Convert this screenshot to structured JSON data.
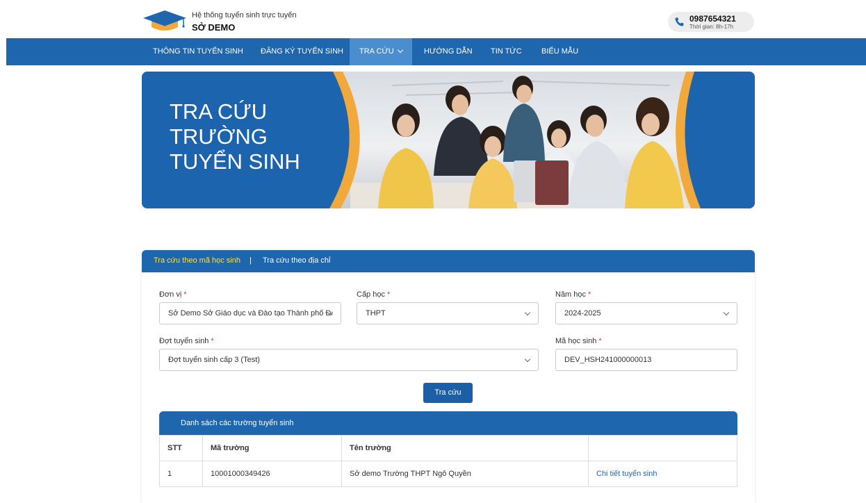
{
  "header": {
    "subtitle": "Hệ thống tuyển sinh trực tuyến",
    "title": "SỞ DEMO",
    "hotline": "0987654321",
    "hours": "Thời gian: 8h-17h"
  },
  "nav": {
    "items": [
      {
        "label": "THÔNG TIN TUYỂN SINH"
      },
      {
        "label": "ĐĂNG KÝ TUYỂN SINH"
      },
      {
        "label": "TRA CỨU"
      },
      {
        "label": "HƯỚNG DẪN"
      },
      {
        "label": "TIN TỨC"
      },
      {
        "label": "BIỂU MẪU"
      }
    ],
    "active_index": 2
  },
  "banner": {
    "line1": "TRA CỨU",
    "line2": "TRƯỜNG",
    "line3": "TUYỂN SINH"
  },
  "tabs": {
    "tab1": "Tra cứu theo mã học sinh",
    "separator": "|",
    "tab2": "Tra cứu theo địa chỉ",
    "active": "tab1"
  },
  "form": {
    "don_vi": {
      "label": "Đơn vị",
      "value": "Sở Demo Sở Giáo dục và Đào tạo Thành phố Đà Nẵng"
    },
    "cap_hoc": {
      "label": "Cấp học",
      "value": "THPT"
    },
    "nam_hoc": {
      "label": "Năm học",
      "value": "2024-2025"
    },
    "dot": {
      "label": "Đợt tuyển sinh",
      "value": "Đợt tuyển sinh cấp 3 (Test)"
    },
    "ma_hs": {
      "label": "Mã học sinh",
      "value": "DEV_HSH241000000013"
    },
    "required_mark": "*",
    "submit": "Tra cứu"
  },
  "results": {
    "title": "Danh sách các trường tuyển sinh",
    "columns": [
      "STT",
      "Mã trường",
      "Tên trường",
      ""
    ],
    "rows": [
      {
        "stt": "1",
        "ma": "10001000349426",
        "ten": "Sở demo Trường THPT Ngô Quyền",
        "action": "Chi tiết tuyển sinh"
      }
    ]
  },
  "colors": {
    "primary": "#1e66ad",
    "nav_active": "#4b8ed0",
    "active_tab_text": "#f7e24c",
    "accent_orange": "#f2a93b",
    "required": "#d9332e"
  }
}
